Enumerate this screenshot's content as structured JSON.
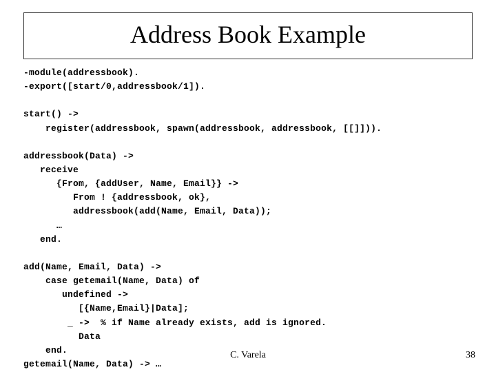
{
  "title": "Address Book Example",
  "code": {
    "l01": "-module(addressbook).",
    "l02": "-export([start/0,addressbook/1]).",
    "l03": "",
    "l04": "start() ->",
    "l05": "    register(addressbook, spawn(addressbook, addressbook, [[]])).",
    "l06": "",
    "l07": "addressbook(Data) ->",
    "l08": "   receive",
    "l09": "      {From, {addUser, Name, Email}} ->",
    "l10": "         From ! {addressbook, ok},",
    "l11": "         addressbook(add(Name, Email, Data));",
    "l12": "      …",
    "l13": "   end.",
    "l14": "",
    "l15": "add(Name, Email, Data) ->",
    "l16": "    case getemail(Name, Data) of",
    "l17": "       undefined ->",
    "l18": "          [{Name,Email}|Data];",
    "l19": "        _ ->  % if Name already exists, add is ignored.",
    "l20": "          Data",
    "l21": "    end.",
    "l22": "getemail(Name, Data) -> …"
  },
  "footer": {
    "author": "C. Varela",
    "page": "38"
  }
}
